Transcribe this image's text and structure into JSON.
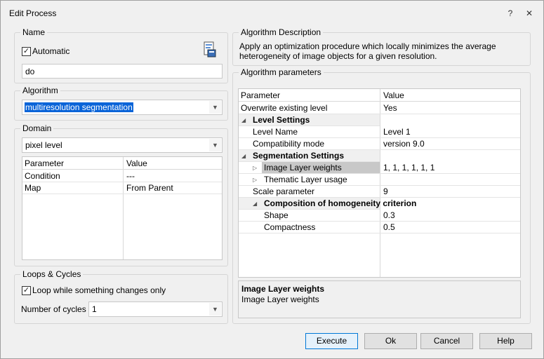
{
  "window": {
    "title": "Edit Process",
    "help_glyph": "?",
    "close_glyph": "✕"
  },
  "name_group": {
    "label": "Name",
    "automatic_label": "Automatic",
    "automatic_checked": true,
    "name_value": "do"
  },
  "algorithm_group": {
    "label": "Algorithm",
    "selected": "multiresolution segmentation"
  },
  "domain_group": {
    "label": "Domain",
    "selected": "pixel level",
    "columns": [
      "Parameter",
      "Value"
    ],
    "rows": [
      {
        "param": "Condition",
        "value": "---"
      },
      {
        "param": "Map",
        "value": "From Parent"
      }
    ]
  },
  "loops_group": {
    "label": "Loops & Cycles",
    "loop_label": "Loop while something changes only",
    "loop_checked": true,
    "cycles_label": "Number of cycles",
    "cycles_value": "1"
  },
  "description_group": {
    "label": "Algorithm Description",
    "text": "Apply an optimization procedure which locally minimizes the average heterogeneity of image objects for a given resolution."
  },
  "params_group": {
    "label": "Algorithm parameters",
    "columns": [
      "Parameter",
      "Value"
    ],
    "rows": [
      {
        "param": "Overwrite existing level",
        "value": "Yes"
      },
      {
        "section": "Level Settings"
      },
      {
        "param": "Level Name",
        "value": "Level 1"
      },
      {
        "param": "Compatibility mode",
        "value": "version 9.0"
      },
      {
        "section": "Segmentation Settings"
      },
      {
        "param": "Image Layer weights",
        "value": "1, 1, 1, 1, 1, 1"
      },
      {
        "param": "Thematic Layer usage",
        "value": ""
      },
      {
        "param": "Scale parameter",
        "value": "9"
      },
      {
        "section": "Composition of homogeneity criterion"
      },
      {
        "param": "Shape",
        "value": "0.3"
      },
      {
        "param": "Compactness",
        "value": "0.5"
      }
    ],
    "help_title": "Image Layer weights",
    "help_text": "Image Layer weights"
  },
  "buttons": {
    "execute": "Execute",
    "ok": "Ok",
    "cancel": "Cancel",
    "help": "Help"
  },
  "glyphs": {
    "check": "✓",
    "collapse": "◢",
    "expand": "▷",
    "dropdown": "▼"
  }
}
